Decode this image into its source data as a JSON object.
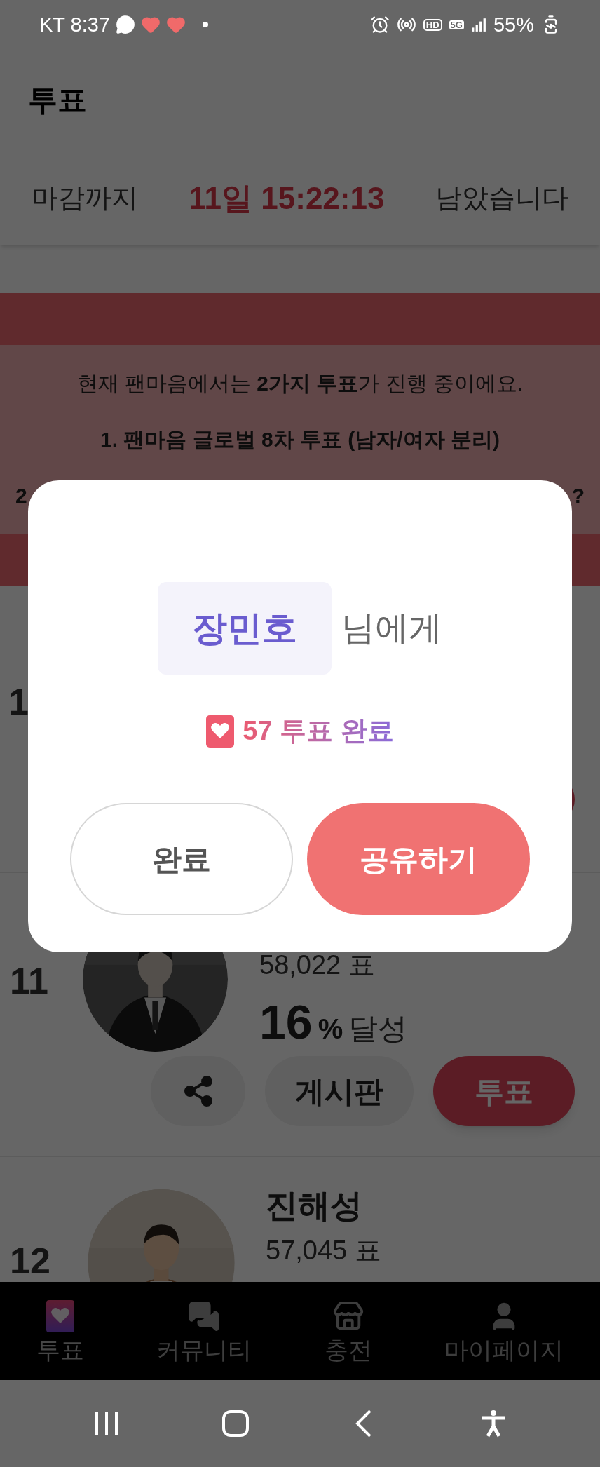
{
  "status_bar": {
    "carrier_time": "KT 8:37",
    "hd": "HD",
    "network": "5G",
    "battery": "55%"
  },
  "header": {
    "title": "투표"
  },
  "countdown": {
    "prefix": "마감까지",
    "remaining": "11일 15:22:13",
    "suffix": "남았습니다"
  },
  "banner": {
    "lines": [
      {
        "text": "현재 팬마음에서는 **2가지 투표**가 진행 중이에요.",
        "bold": false
      },
      {
        "text": "1. 팬마음 글로벌 8차 투표 (남자/여자 분리)",
        "bold": true
      }
    ],
    "partial_line": {
      "start": "2",
      "end": "?"
    }
  },
  "ranking": [
    {
      "kind": "covered",
      "rank": "1"
    },
    {
      "kind": "full",
      "rank": "11",
      "votes": "58,022 표",
      "percent": "16",
      "percent_unit": "%",
      "achieved": "달성",
      "board_button": "게시판",
      "vote_button": "투표"
    },
    {
      "kind": "cut",
      "rank": "12",
      "name": "진해성",
      "votes": "57,045 표"
    }
  ],
  "modal": {
    "recipient": "장민호",
    "recipient_suffix": "님에게",
    "result": "57 투표 완료",
    "buttons": [
      {
        "label": "완료",
        "kind": "secondary"
      },
      {
        "label": "공유하기",
        "kind": "primary"
      }
    ]
  },
  "bottom_nav": [
    {
      "label": "투표",
      "kind": "vote",
      "selected": true
    },
    {
      "label": "커뮤니티",
      "kind": "community",
      "selected": false
    },
    {
      "label": "충전",
      "kind": "charge",
      "selected": false
    },
    {
      "label": "마이페이지",
      "kind": "mypage",
      "selected": false
    }
  ]
}
